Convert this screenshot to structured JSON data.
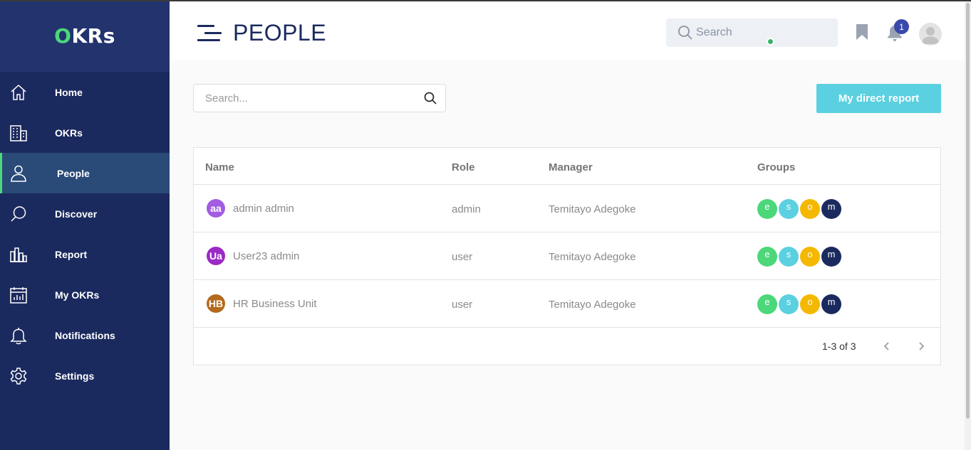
{
  "app": {
    "logo_first": "O",
    "logo_rest": "KRs"
  },
  "sidebar": {
    "items": [
      {
        "label": "Home",
        "icon": "home-icon"
      },
      {
        "label": "OKRs",
        "icon": "building-icon"
      },
      {
        "label": "People",
        "icon": "person-icon",
        "active": true
      },
      {
        "label": "Discover",
        "icon": "search-icon"
      },
      {
        "label": "Report",
        "icon": "bar-chart-icon"
      },
      {
        "label": "My OKRs",
        "icon": "calendar-chart-icon"
      },
      {
        "label": "Notifications",
        "icon": "bell-icon"
      },
      {
        "label": "Settings",
        "icon": "gear-icon"
      }
    ]
  },
  "header": {
    "title": "PEOPLE",
    "search_placeholder": "Search",
    "notification_count": "1"
  },
  "content": {
    "search_placeholder": "Search...",
    "direct_report_label": "My direct report"
  },
  "table": {
    "headers": {
      "name": "Name",
      "role": "Role",
      "manager": "Manager",
      "groups": "Groups"
    },
    "rows": [
      {
        "initials": "aa",
        "name": "admin admin",
        "role": "admin",
        "manager": "Temitayo Adegoke",
        "avatar_color": "#a35de0"
      },
      {
        "initials": "Ua",
        "name": "User23 admin",
        "role": "user",
        "manager": "Temitayo Adegoke",
        "avatar_color": "#9b2ac6"
      },
      {
        "initials": "HB",
        "name": "HR Business Unit",
        "role": "user",
        "manager": "Temitayo Adegoke",
        "avatar_color": "#b36a1c"
      }
    ],
    "groups": [
      {
        "letter": "e",
        "color": "#4cd77a"
      },
      {
        "letter": "s",
        "color": "#5bd0e0"
      },
      {
        "letter": "o",
        "color": "#f5b800"
      },
      {
        "letter": "m",
        "color": "#1b2a5e"
      }
    ],
    "pagination": "1-3 of 3"
  },
  "colors": {
    "sidebar_bg": "#1b2a5e",
    "active_item_bg": "#2a4a78",
    "accent_green": "#4cd77a",
    "button_cyan": "#5bd0e0"
  }
}
